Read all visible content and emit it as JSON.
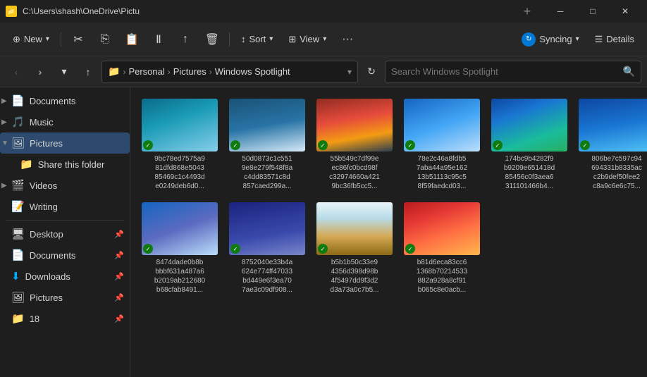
{
  "titleBar": {
    "icon": "📁",
    "title": "C:\\Users\\shash\\OneDrive\\Pictu",
    "newTabTitle": "+",
    "minimizeBtn": "─",
    "maximizeBtn": "□",
    "closeBtn": "✕"
  },
  "toolbar": {
    "newLabel": "New",
    "cutLabel": "✂",
    "copyLabel": "⎘",
    "pasteLabel": "📋",
    "renameLabel": "✏",
    "shareLabel": "↑",
    "deleteLabel": "🗑",
    "sortLabel": "Sort",
    "viewLabel": "View",
    "moreLabel": "···",
    "syncingLabel": "Syncing",
    "detailsLabel": "Details"
  },
  "addressBar": {
    "breadcrumb": {
      "folder1": "Personal",
      "folder2": "Pictures",
      "folder3": "Windows Spotlight"
    },
    "searchPlaceholder": "Search Windows Spotlight"
  },
  "sidebar": {
    "items": [
      {
        "id": "documents-top",
        "label": "Documents",
        "icon": "📄",
        "expandable": true,
        "pinned": false
      },
      {
        "id": "music",
        "label": "Music",
        "icon": "🎵",
        "expandable": true,
        "pinned": false
      },
      {
        "id": "pictures",
        "label": "Pictures",
        "icon": "🖼",
        "expandable": true,
        "pinned": false,
        "active": true
      },
      {
        "id": "share-folder",
        "label": "Share this folder",
        "icon": "📁",
        "expandable": false,
        "pinned": false
      },
      {
        "id": "videos",
        "label": "Videos",
        "icon": "🎬",
        "expandable": true,
        "pinned": false
      },
      {
        "id": "writing",
        "label": "Writing",
        "icon": "📝",
        "expandable": false,
        "pinned": false
      },
      {
        "id": "desktop",
        "label": "Desktop",
        "icon": "🖥",
        "expandable": false,
        "pinned": true
      },
      {
        "id": "documents-bot",
        "label": "Documents",
        "icon": "📄",
        "expandable": false,
        "pinned": true
      },
      {
        "id": "downloads",
        "label": "Downloads",
        "icon": "⬇",
        "expandable": false,
        "pinned": true
      },
      {
        "id": "pictures-bot",
        "label": "Pictures",
        "icon": "🖼",
        "expandable": false,
        "pinned": true
      },
      {
        "id": "18",
        "label": "18",
        "icon": "📁",
        "expandable": false,
        "pinned": true
      }
    ]
  },
  "files": [
    {
      "id": 1,
      "name": "9bc78ed7575a9\n81dfd868e5043\n85469c1c4493d\ne0249deb6d0...",
      "thumb": "thumb-1",
      "synced": true
    },
    {
      "id": 2,
      "name": "50d0873c1c551\n9e8e279f548f8a\nc4dd83571c8d\n857caed299a...",
      "thumb": "thumb-2",
      "synced": true
    },
    {
      "id": 3,
      "name": "55b549c7df99e\nec86fc0bcd98f\nc32974660a421\n9bc36fb5cc5...",
      "thumb": "thumb-3",
      "synced": true
    },
    {
      "id": 4,
      "name": "78e2c46a8fdb5\n7aba44a95e162\n13b51113c95c5\n8f59faedcd03...",
      "thumb": "thumb-4",
      "synced": true
    },
    {
      "id": 5,
      "name": "174bc9b4282f9\nb9209e651418d\n85456c0f3aea6\n311101466b4...",
      "thumb": "thumb-5",
      "synced": true
    },
    {
      "id": 6,
      "name": "806be7c597c94\n694331b8335ac\nc2b9def50fee2\nc8a9c6e6c75...",
      "thumb": "thumb-6",
      "synced": true
    },
    {
      "id": 7,
      "name": "",
      "thumb": "thumb-7-empty",
      "synced": false
    },
    {
      "id": 8,
      "name": "8474dade0b8b\nbbbf631a487a6\nb2019ab212680\nb68cfab8491...",
      "thumb": "thumb-8",
      "synced": true
    },
    {
      "id": 9,
      "name": "8752040e33b4a\n624e774ff47033\nbd449e6f3ea70\n7ae3c09df908...",
      "thumb": "thumb-9",
      "synced": true
    },
    {
      "id": 10,
      "name": "b5b1b50c33e9\n4356d398d98b\n4f5497dd9f3d2\nd3a73a0c7b5...",
      "thumb": "thumb-10",
      "synced": true
    },
    {
      "id": 11,
      "name": "b81d6eca83cc6\n1368b70214533\n882a928a8cf91\nb065c8e0acb...",
      "thumb": "thumb-11",
      "synced": true
    }
  ]
}
